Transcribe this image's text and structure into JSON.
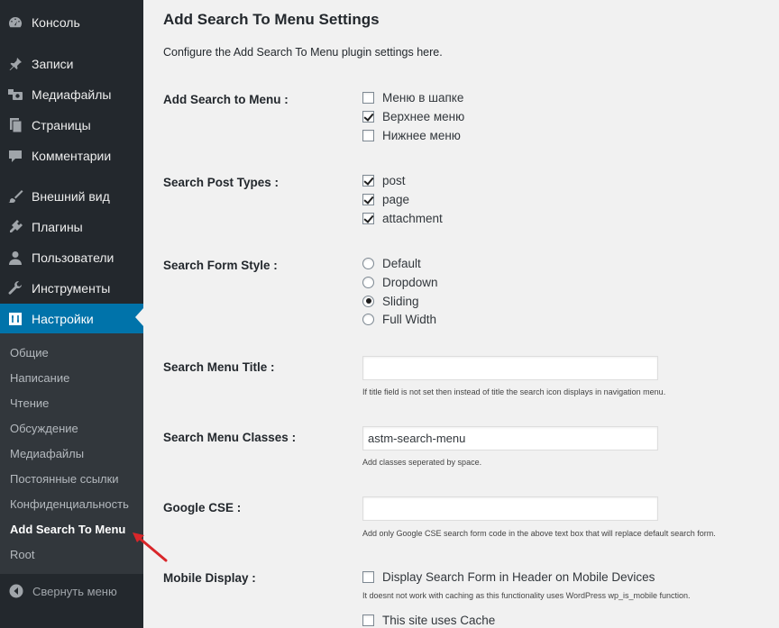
{
  "sidebar": {
    "menu": [
      {
        "label": "Консоль",
        "icon": "dashboard-icon"
      },
      {
        "label": "Записи",
        "icon": "pin-icon"
      },
      {
        "label": "Медиафайлы",
        "icon": "media-icon"
      },
      {
        "label": "Страницы",
        "icon": "pages-icon"
      },
      {
        "label": "Комментарии",
        "icon": "comment-icon"
      },
      {
        "label": "Внешний вид",
        "icon": "brush-icon"
      },
      {
        "label": "Плагины",
        "icon": "plug-icon"
      },
      {
        "label": "Пользователи",
        "icon": "user-icon"
      },
      {
        "label": "Инструменты",
        "icon": "wrench-icon"
      },
      {
        "label": "Настройки",
        "icon": "settings-icon"
      }
    ],
    "submenu": [
      "Общие",
      "Написание",
      "Чтение",
      "Обсуждение",
      "Медиафайлы",
      "Постоянные ссылки",
      "Конфиденциальность",
      "Add Search To Menu",
      "Root"
    ],
    "collapse_label": "Свернуть меню"
  },
  "page": {
    "title": "Add Search To Menu Settings",
    "description": "Configure the Add Search To Menu plugin settings here."
  },
  "settings": {
    "add_to_menu": {
      "label": "Add Search to Menu :",
      "options": [
        {
          "label": "Меню в шапке",
          "checked": false
        },
        {
          "label": "Верхнее меню",
          "checked": true
        },
        {
          "label": "Нижнее меню",
          "checked": false
        }
      ]
    },
    "post_types": {
      "label": "Search Post Types :",
      "options": [
        {
          "label": "post",
          "checked": true
        },
        {
          "label": "page",
          "checked": true
        },
        {
          "label": "attachment",
          "checked": true
        }
      ]
    },
    "form_style": {
      "label": "Search Form Style :",
      "options": [
        {
          "label": "Default",
          "selected": false
        },
        {
          "label": "Dropdown",
          "selected": false
        },
        {
          "label": "Sliding",
          "selected": true
        },
        {
          "label": "Full Width",
          "selected": false
        }
      ]
    },
    "menu_title": {
      "label": "Search Menu Title :",
      "value": "",
      "hint": "If title field is not set then instead of title the search icon displays in navigation menu."
    },
    "menu_classes": {
      "label": "Search Menu Classes :",
      "value": "astm-search-menu",
      "hint": "Add classes seperated by space."
    },
    "google_cse": {
      "label": "Google CSE :",
      "value": "",
      "hint": "Add only Google CSE search form code in the above text box that will replace default search form."
    },
    "mobile_display": {
      "label": "Mobile Display :",
      "option_label": "Display Search Form in Header on Mobile Devices",
      "option_checked": false,
      "hint": "It doesnt not work with caching as this functionality uses WordPress wp_is_mobile function.",
      "cache_label": "This site uses Cache",
      "cache_checked": false
    }
  },
  "colors": {
    "sidebar_bg": "#23282d",
    "submenu_bg": "#32373c",
    "active_bg": "#0073aa",
    "page_bg": "#f1f1f1",
    "annotation_arrow": "#d9262a"
  }
}
